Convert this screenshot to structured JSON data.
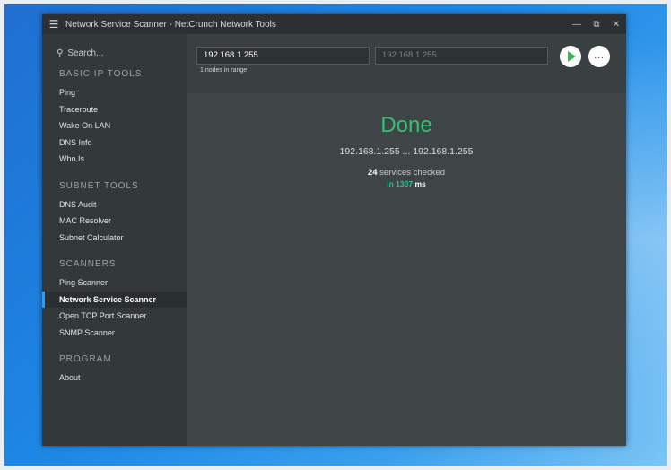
{
  "window": {
    "title": "Network Service Scanner - NetCrunch Network Tools"
  },
  "sidebar": {
    "search_label": "Search...",
    "sections": [
      {
        "title": "BASIC IP TOOLS",
        "items": [
          "Ping",
          "Traceroute",
          "Wake On LAN",
          "DNS Info",
          "Who Is"
        ]
      },
      {
        "title": "SUBNET TOOLS",
        "items": [
          "DNS Audit",
          "MAC Resolver",
          "Subnet Calculator"
        ]
      },
      {
        "title": "SCANNERS",
        "items": [
          "Ping Scanner",
          "Network Service Scanner",
          "Open TCP Port Scanner",
          "SNMP Scanner"
        ]
      },
      {
        "title": "PROGRAM",
        "items": [
          "About"
        ]
      }
    ],
    "active_item": "Network Service Scanner"
  },
  "toolbar": {
    "start_ip": "192.168.1.255",
    "end_ip_placeholder": "192.168.1.255",
    "range_info": "1 nodes in range"
  },
  "result": {
    "status": "Done",
    "range": "192.168.1.255 ... 192.168.1.255",
    "services_count": "24",
    "services_label": " services checked",
    "time_prefix": "in 1307",
    "time_unit": " ms"
  },
  "colors": {
    "status_green": "#36c172",
    "accent_blue": "#1aa3ff",
    "play_green": "#34b94a"
  }
}
